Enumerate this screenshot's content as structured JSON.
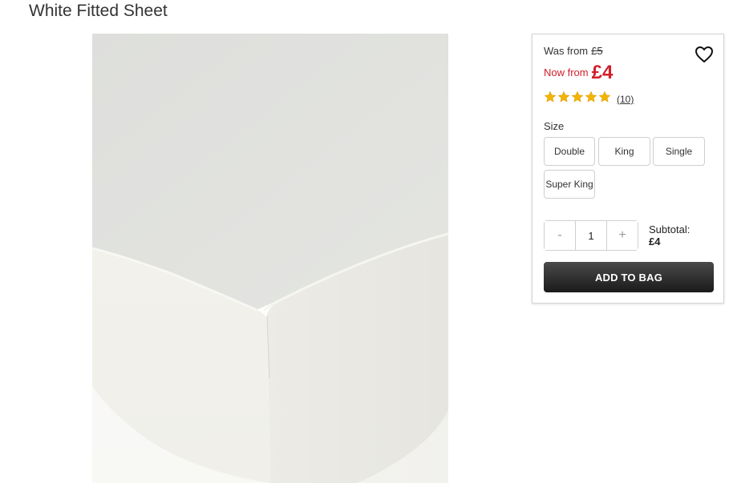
{
  "product": {
    "title": "White Fitted Sheet"
  },
  "pricing": {
    "was_label": "Was from",
    "was_price": "£5",
    "now_label": "Now from",
    "now_price": "£4",
    "accent_color": "#d0202b"
  },
  "rating": {
    "stars": 5,
    "max_stars": 5,
    "review_count": "(10)",
    "star_color": "#f4b400"
  },
  "size": {
    "label": "Size",
    "options": [
      "Double",
      "King",
      "Single",
      "Super King"
    ]
  },
  "quantity": {
    "decrement_label": "-",
    "value": "1",
    "increment_label": "+"
  },
  "subtotal": {
    "label": "Subtotal:",
    "value": "£4"
  },
  "actions": {
    "add_to_bag": "ADD TO BAG",
    "wishlist_icon": "heart-icon"
  }
}
